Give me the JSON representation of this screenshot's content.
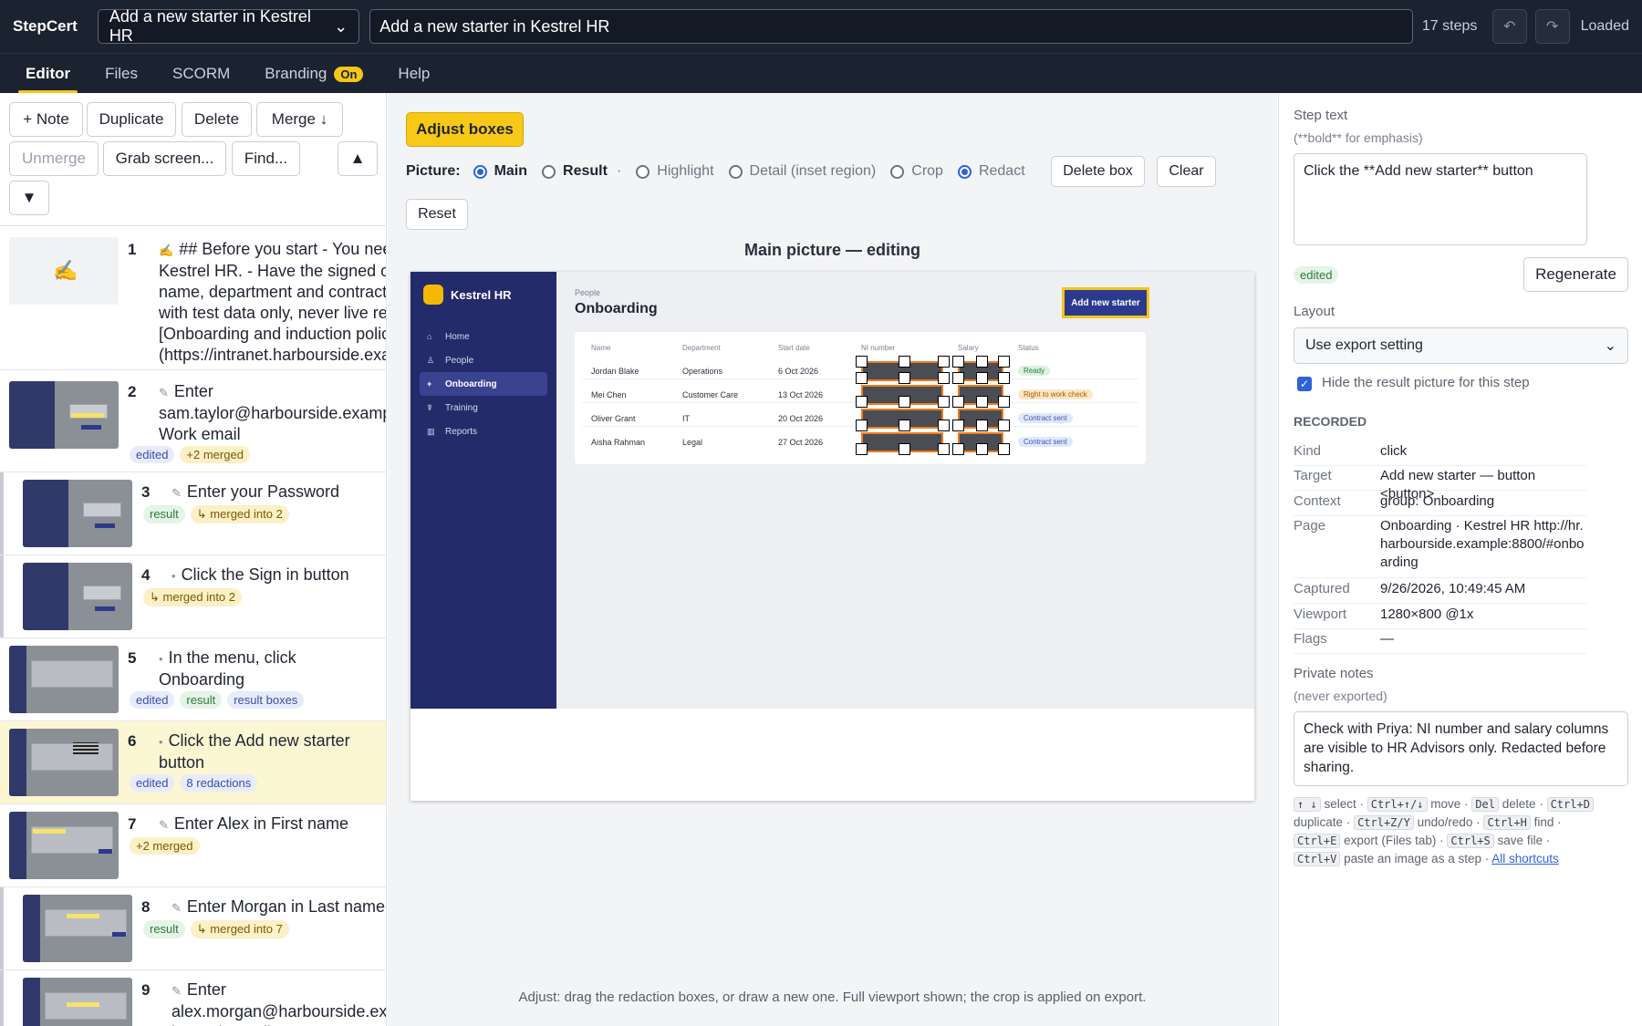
{
  "topbar": {
    "logo": "StepCert",
    "guide_select": "Add a new starter in Kestrel HR",
    "guide_title": "Add a new starter in Kestrel HR",
    "steps_count": "17 steps",
    "undo_icon": "↶",
    "redo_icon": "↷",
    "status": "Loaded"
  },
  "tabs": [
    {
      "label": "Editor"
    },
    {
      "label": "Files"
    },
    {
      "label": "SCORM"
    },
    {
      "label": "Branding",
      "badge": "On"
    },
    {
      "label": "Help"
    }
  ],
  "left_buttons": {
    "note": "+ Note",
    "duplicate": "Duplicate",
    "delete": "Delete",
    "merge": "Merge ↓",
    "unmerge": "Unmerge",
    "grab": "Grab screen...",
    "find": "Find...",
    "up": "▲",
    "down": "▼"
  },
  "steps": [
    {
      "num": "1",
      "icon": "✍",
      "text": "## Before you start - You need access to Kestrel HR. - Have the signed offer letter with full name, department and contract type. Practise with test data only, never live records. Policy: [Onboarding and induction policy](https://intranet.harbourside.example/policies)",
      "chips": [],
      "note_icon": "✍"
    },
    {
      "num": "2",
      "icon": "✎",
      "text": "Enter sam.taylor@harbourside.example in Work email",
      "chips": [
        {
          "label": "edited",
          "kind": "ed"
        },
        {
          "label": "+2 merged",
          "kind": "mg"
        }
      ]
    },
    {
      "num": "3",
      "icon": "✎",
      "text": "Enter your Password",
      "chips": [
        {
          "label": "result",
          "kind": "rs"
        },
        {
          "label": "↳ merged into 2",
          "kind": "mg"
        }
      ]
    },
    {
      "num": "4",
      "icon": "•",
      "text": "Click the Sign in button",
      "chips": [
        {
          "label": "↳ merged into 2",
          "kind": "mg"
        }
      ]
    },
    {
      "num": "5",
      "icon": "•",
      "text": "In the menu, click Onboarding",
      "chips": [
        {
          "label": "edited",
          "kind": "ed"
        },
        {
          "label": "result",
          "kind": "rs"
        },
        {
          "label": "result boxes",
          "kind": "ed"
        }
      ]
    },
    {
      "num": "6",
      "icon": "•",
      "text": "Click the Add new starter button",
      "chips": [
        {
          "label": "edited",
          "kind": "ed"
        },
        {
          "label": "8 redactions",
          "kind": "ed"
        }
      ]
    },
    {
      "num": "7",
      "icon": "✎",
      "text": "Enter Alex in First name",
      "chips": [
        {
          "label": "+2 merged",
          "kind": "mg"
        }
      ]
    },
    {
      "num": "8",
      "icon": "✎",
      "text": "Enter Morgan in Last name",
      "chips": [
        {
          "label": "result",
          "kind": "rs"
        },
        {
          "label": "↳ merged into 7",
          "kind": "mg"
        }
      ]
    },
    {
      "num": "9",
      "icon": "✎",
      "text": "Enter alex.morgan@harbourside.example in Work email",
      "chips": []
    }
  ],
  "middle": {
    "adjust_label": "Adjust boxes",
    "picture_label": "Picture:",
    "radios": [
      {
        "label": "Main",
        "on": true
      },
      {
        "label": "Result",
        "on": false
      },
      {
        "label": "Highlight",
        "on": false
      },
      {
        "label": "Detail (inset region)",
        "on": false
      },
      {
        "label": "Crop",
        "on": false
      },
      {
        "label": "Redact",
        "on": true
      }
    ],
    "sep": "·",
    "delete_box": "Delete box",
    "clear": "Clear",
    "reset": "Reset",
    "title": "Main picture — editing",
    "footer": "Adjust: drag the redaction boxes, or draw a new one. Full viewport shown; the crop is applied on export."
  },
  "screenshot": {
    "app_name": "Kestrel HR",
    "nav": [
      "Home",
      "People",
      "Onboarding",
      "Training",
      "Reports"
    ],
    "nav_icons": [
      "⌂",
      "♙",
      "+",
      "☤",
      "▥"
    ],
    "breadcrumb": "People",
    "heading": "Onboarding",
    "add_button": "Add new starter",
    "columns": [
      "Name",
      "Department",
      "Start date",
      "NI number",
      "Salary",
      "Status"
    ],
    "rows": [
      {
        "name": "Jordan Blake",
        "dept": "Operations",
        "start": "6 Oct 2026",
        "status": "Ready",
        "st": "ready"
      },
      {
        "name": "Mei Chen",
        "dept": "Customer Care",
        "start": "13 Oct 2026",
        "status": "Right to work check",
        "st": "rtw"
      },
      {
        "name": "Oliver Grant",
        "dept": "IT",
        "start": "20 Oct 2026",
        "status": "Contract sent",
        "st": "cs"
      },
      {
        "name": "Aisha Rahman",
        "dept": "Legal",
        "start": "27 Oct 2026",
        "status": "Contract sent",
        "st": "cs"
      }
    ]
  },
  "right": {
    "step_text_label": "Step text",
    "step_text_hint": "(**bold** for emphasis)",
    "step_text": "Click the **Add new starter** button",
    "edited_chip": "edited",
    "regenerate": "Regenerate",
    "layout_label": "Layout",
    "layout_value": "Use export setting",
    "hide_result": "Hide the result picture for this step",
    "recorded_heading": "RECORDED",
    "recorded": [
      {
        "k": "Kind",
        "v": "click"
      },
      {
        "k": "Target",
        "v": "Add new starter — button <button>"
      },
      {
        "k": "Context",
        "v": "group: Onboarding"
      },
      {
        "k": "Page",
        "v": "Onboarding · Kestrel HR http://hr.harbourside.example:8800/#onboarding"
      },
      {
        "k": "Captured",
        "v": "9/26/2026, 10:49:45 AM"
      },
      {
        "k": "Viewport",
        "v": "1280×800 @1x"
      },
      {
        "k": "Flags",
        "v": "—"
      }
    ],
    "private_label": "Private notes",
    "private_hint": "(never exported)",
    "private_notes": "Check with Priya: NI number and salary columns are visible to HR Advisors only. Redacted before sharing.",
    "shortcuts": [
      {
        "key": "↑ ↓",
        "desc": "select ·"
      },
      {
        "key": "Ctrl+↑/↓",
        "desc": "move ·"
      },
      {
        "key": "Del",
        "desc": "delete ·"
      },
      {
        "key": "Ctrl+D",
        "desc": "duplicate ·"
      },
      {
        "key": "Ctrl+Z/Y",
        "desc": "undo/redo ·"
      },
      {
        "key": "Ctrl+H",
        "desc": "find ·"
      },
      {
        "key": "Ctrl+E",
        "desc": "export (Files tab) ·"
      },
      {
        "key": "Ctrl+S",
        "desc": "save file ·"
      },
      {
        "key": "Ctrl+V",
        "desc": "paste an image as a step ·"
      }
    ],
    "all_shortcuts": "All shortcuts"
  }
}
